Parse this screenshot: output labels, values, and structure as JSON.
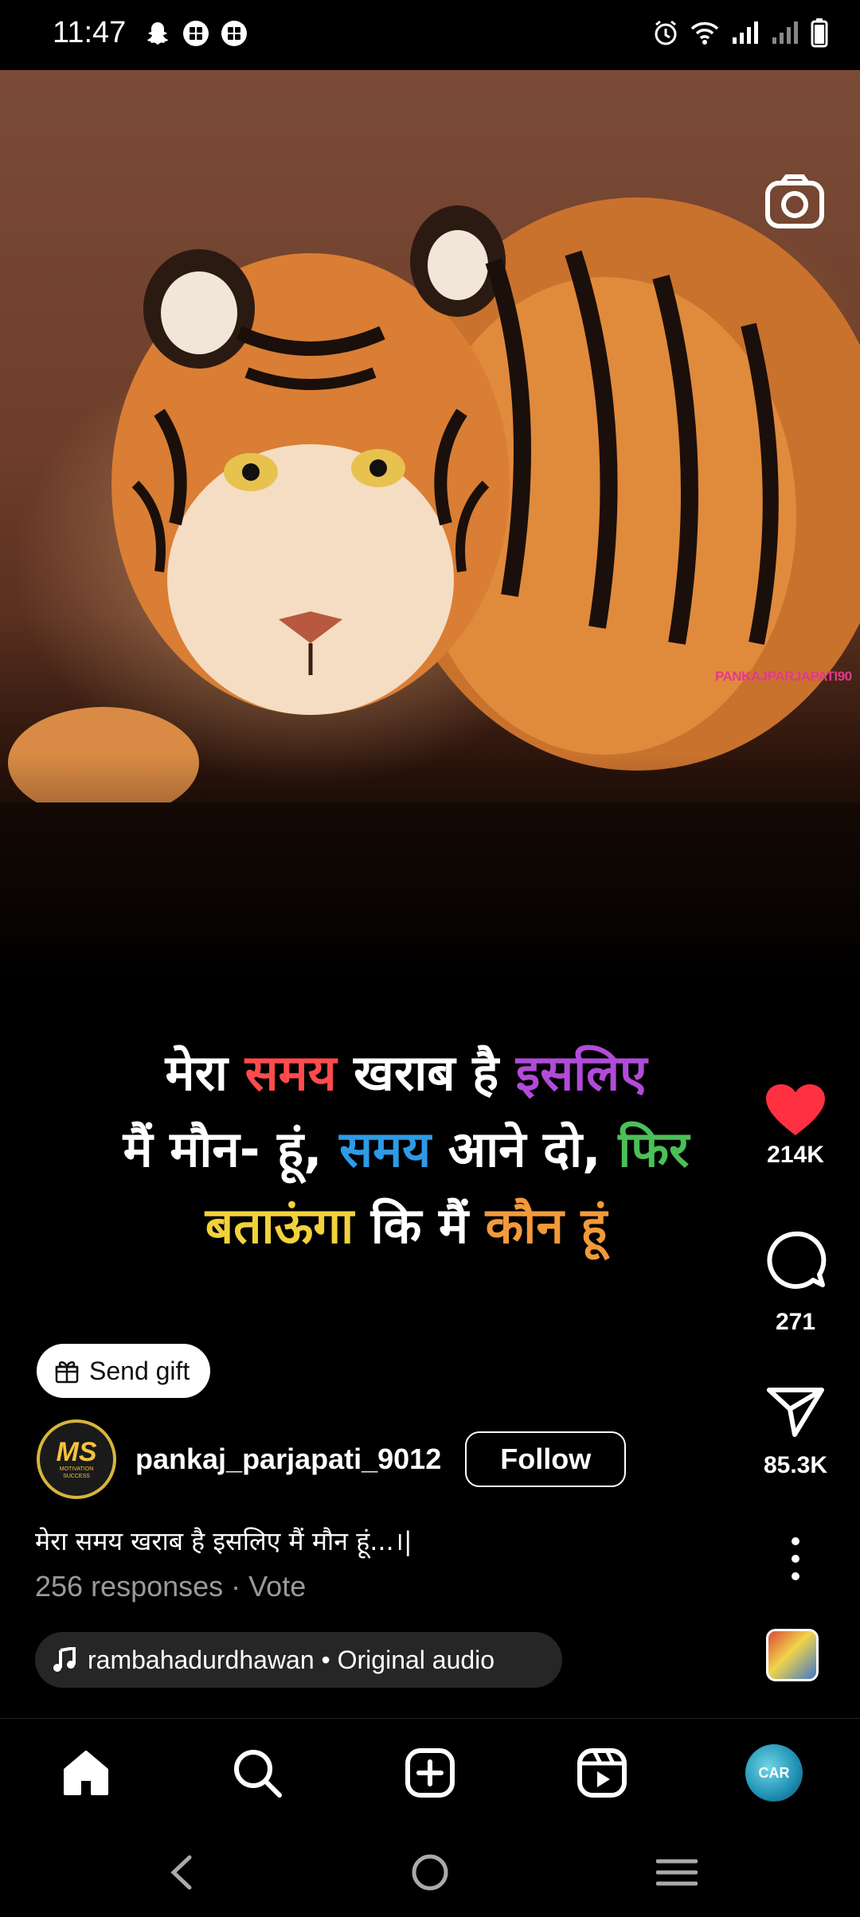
{
  "status_bar": {
    "time": "11:47",
    "left_icons": [
      "snapchat-icon",
      "app-icon",
      "app-icon"
    ],
    "right_icons": [
      "alarm-icon",
      "wifi-icon",
      "signal-icon",
      "signal-icon",
      "battery-icon"
    ]
  },
  "reel": {
    "watermark": "PANKAJPARJAPATI90",
    "overlay_text": {
      "line1": [
        {
          "text": "मेरा ",
          "color": "#ffffff"
        },
        {
          "text": "समय",
          "color": "#ff4b4b"
        },
        {
          "text": " खराब है ",
          "color": "#ffffff"
        },
        {
          "text": "इसलिए",
          "color": "#b14bd9"
        }
      ],
      "line2": [
        {
          "text": "मैं  मौन- हूं, ",
          "color": "#ffffff"
        },
        {
          "text": "समय",
          "color": "#2e9be6"
        },
        {
          "text": " आने दो, ",
          "color": "#ffffff"
        },
        {
          "text": "फिर",
          "color": "#4bbf58"
        }
      ],
      "line3": [
        {
          "text": "बताऊंगा",
          "color": "#f2d23a"
        },
        {
          "text": " कि मैं ",
          "color": "#ffffff"
        },
        {
          "text": "कौन हूं",
          "color": "#f29a3a"
        }
      ]
    }
  },
  "actions": {
    "likes": "214K",
    "comments": "271",
    "shares": "85.3K"
  },
  "send_gift": {
    "label": "Send gift"
  },
  "author": {
    "username": "pankaj_parjapati_9012",
    "follow_label": "Follow",
    "avatar_initials": "MS",
    "avatar_subtext": "MOTIVATION SUCCESS"
  },
  "caption": {
    "text": "मेरा समय खराब है इसलिए मैं मौन हूं...।|",
    "poll": "256 responses · Vote"
  },
  "audio": {
    "label": "rambahadurdhawan • Original audio"
  },
  "bottom_nav": {
    "items": [
      "home-icon",
      "search-icon",
      "create-icon",
      "reels-icon",
      "profile-avatar"
    ],
    "profile_text": "CAR"
  },
  "colors": {
    "like": "#ff3040",
    "background": "#000000",
    "pill": "#262626",
    "muted": "#9a9a9a"
  }
}
